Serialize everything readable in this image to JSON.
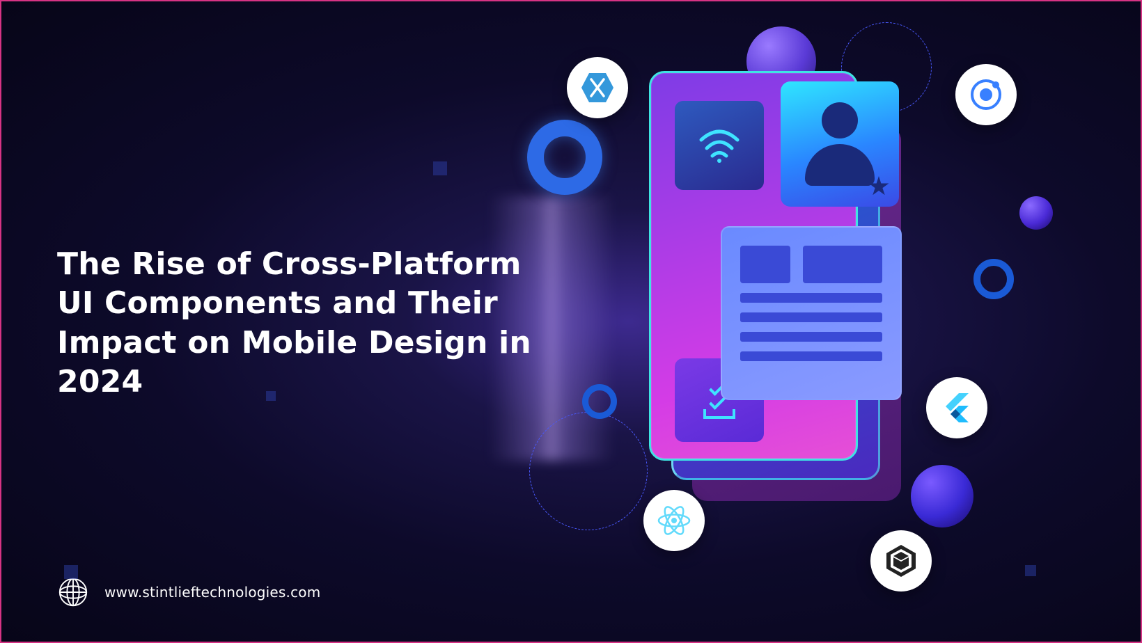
{
  "headline": "The Rise of Cross-Platform UI Components and Their Impact on Mobile Design in 2024",
  "footer": {
    "url": "www.stintlieftechnologies.com"
  },
  "framework_badges": [
    "xamarin",
    "ionic",
    "flutter",
    "unity",
    "react"
  ]
}
